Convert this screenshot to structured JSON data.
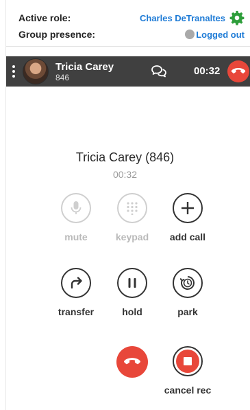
{
  "header": {
    "active_role_label": "Active role:",
    "active_role_user": "Charles DeTranaltes",
    "group_presence_label": "Group presence:",
    "presence_status": "Logged out",
    "presence_color": "#a9a9a9",
    "link_color": "#1e7bd6",
    "settings_icon": "gear-icon",
    "settings_color": "#2e9e3b"
  },
  "call_bar": {
    "name": "Tricia Carey",
    "extension": "846",
    "timer": "00:32",
    "background": "#404040",
    "hangup_color": "#e8473a"
  },
  "call": {
    "caller": "Tricia Carey (846)",
    "timer": "00:32"
  },
  "controls": {
    "mute": {
      "label": "mute",
      "icon": "microphone-icon",
      "enabled": false
    },
    "keypad": {
      "label": "keypad",
      "icon": "keypad-icon",
      "enabled": false
    },
    "add_call": {
      "label": "add call",
      "icon": "plus-icon",
      "enabled": true
    },
    "transfer": {
      "label": "transfer",
      "icon": "transfer-arrow-icon",
      "enabled": true
    },
    "hold": {
      "label": "hold",
      "icon": "pause-icon",
      "enabled": true
    },
    "park": {
      "label": "park",
      "icon": "clock-icon",
      "enabled": true
    },
    "hangup": {
      "icon": "hangup-icon",
      "color": "#e8473a"
    },
    "cancel_rec": {
      "label": "cancel rec",
      "icon": "stop-record-icon",
      "color": "#e8473a"
    }
  }
}
